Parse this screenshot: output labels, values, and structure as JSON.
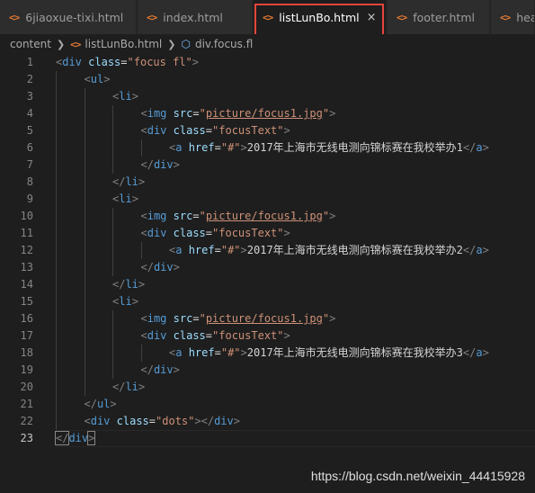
{
  "tabs": [
    {
      "label": "6jiaoxue-tixi.html",
      "icon": "html-icon",
      "active": false
    },
    {
      "label": "index.html",
      "icon": "html-icon",
      "active": false
    },
    {
      "label": "listLunBo.html",
      "icon": "html-icon",
      "active": true,
      "close": "×"
    },
    {
      "label": "footer.html",
      "icon": "html-icon",
      "active": false
    },
    {
      "label": "hea",
      "icon": "html-icon",
      "active": false
    }
  ],
  "icon_glyph": "<>",
  "breadcrumb": {
    "folder": "content",
    "file": "listLunBo.html",
    "symbol": "div.focus.fl"
  },
  "colors": {
    "tag": "#569cd6",
    "attr": "#9cdcfe",
    "string": "#ce9178",
    "punct": "#808080",
    "html_icon": "#e37933",
    "highlight_box": "#e8453c"
  },
  "code_lines": [
    {
      "n": "1",
      "indent": 0,
      "tokens": [
        [
          "p",
          "<"
        ],
        [
          "t",
          "div"
        ],
        [
          "x",
          " "
        ],
        [
          "a",
          "class"
        ],
        [
          "x",
          "="
        ],
        [
          "s",
          "\"focus fl\""
        ],
        [
          "p",
          ">"
        ]
      ]
    },
    {
      "n": "2",
      "indent": 1,
      "tokens": [
        [
          "p",
          "<"
        ],
        [
          "t",
          "ul"
        ],
        [
          "p",
          ">"
        ]
      ]
    },
    {
      "n": "3",
      "indent": 2,
      "tokens": [
        [
          "p",
          "<"
        ],
        [
          "t",
          "li"
        ],
        [
          "p",
          ">"
        ]
      ]
    },
    {
      "n": "4",
      "indent": 3,
      "tokens": [
        [
          "p",
          "<"
        ],
        [
          "t",
          "img"
        ],
        [
          "x",
          " "
        ],
        [
          "a",
          "src"
        ],
        [
          "x",
          "="
        ],
        [
          "s",
          "\""
        ],
        [
          "su",
          "picture/focus1.jpg"
        ],
        [
          "s",
          "\""
        ],
        [
          "p",
          ">"
        ]
      ]
    },
    {
      "n": "5",
      "indent": 3,
      "tokens": [
        [
          "p",
          "<"
        ],
        [
          "t",
          "div"
        ],
        [
          "x",
          " "
        ],
        [
          "a",
          "class"
        ],
        [
          "x",
          "="
        ],
        [
          "s",
          "\"focusText\""
        ],
        [
          "p",
          ">"
        ]
      ]
    },
    {
      "n": "6",
      "indent": 4,
      "tokens": [
        [
          "p",
          "<"
        ],
        [
          "t",
          "a"
        ],
        [
          "x",
          " "
        ],
        [
          "a",
          "href"
        ],
        [
          "x",
          "="
        ],
        [
          "s",
          "\"#\""
        ],
        [
          "p",
          ">"
        ],
        [
          "x",
          "2017年上海市无线电测向锦标赛在我校举办1"
        ],
        [
          "p",
          "</"
        ],
        [
          "t",
          "a"
        ],
        [
          "p",
          ">"
        ]
      ]
    },
    {
      "n": "7",
      "indent": 3,
      "tokens": [
        [
          "p",
          "</"
        ],
        [
          "t",
          "div"
        ],
        [
          "p",
          ">"
        ]
      ]
    },
    {
      "n": "8",
      "indent": 2,
      "tokens": [
        [
          "p",
          "</"
        ],
        [
          "t",
          "li"
        ],
        [
          "p",
          ">"
        ]
      ]
    },
    {
      "n": "9",
      "indent": 2,
      "tokens": [
        [
          "p",
          "<"
        ],
        [
          "t",
          "li"
        ],
        [
          "p",
          ">"
        ]
      ]
    },
    {
      "n": "10",
      "indent": 3,
      "tokens": [
        [
          "p",
          "<"
        ],
        [
          "t",
          "img"
        ],
        [
          "x",
          " "
        ],
        [
          "a",
          "src"
        ],
        [
          "x",
          "="
        ],
        [
          "s",
          "\""
        ],
        [
          "su",
          "picture/focus1.jpg"
        ],
        [
          "s",
          "\""
        ],
        [
          "p",
          ">"
        ]
      ]
    },
    {
      "n": "11",
      "indent": 3,
      "tokens": [
        [
          "p",
          "<"
        ],
        [
          "t",
          "div"
        ],
        [
          "x",
          " "
        ],
        [
          "a",
          "class"
        ],
        [
          "x",
          "="
        ],
        [
          "s",
          "\"focusText\""
        ],
        [
          "p",
          ">"
        ]
      ]
    },
    {
      "n": "12",
      "indent": 4,
      "tokens": [
        [
          "p",
          "<"
        ],
        [
          "t",
          "a"
        ],
        [
          "x",
          " "
        ],
        [
          "a",
          "href"
        ],
        [
          "x",
          "="
        ],
        [
          "s",
          "\"#\""
        ],
        [
          "p",
          ">"
        ],
        [
          "x",
          "2017年上海市无线电测向锦标赛在我校举办2"
        ],
        [
          "p",
          "</"
        ],
        [
          "t",
          "a"
        ],
        [
          "p",
          ">"
        ]
      ]
    },
    {
      "n": "13",
      "indent": 3,
      "tokens": [
        [
          "p",
          "</"
        ],
        [
          "t",
          "div"
        ],
        [
          "p",
          ">"
        ]
      ]
    },
    {
      "n": "14",
      "indent": 2,
      "tokens": [
        [
          "p",
          "</"
        ],
        [
          "t",
          "li"
        ],
        [
          "p",
          ">"
        ]
      ]
    },
    {
      "n": "15",
      "indent": 2,
      "tokens": [
        [
          "p",
          "<"
        ],
        [
          "t",
          "li"
        ],
        [
          "p",
          ">"
        ]
      ]
    },
    {
      "n": "16",
      "indent": 3,
      "tokens": [
        [
          "p",
          "<"
        ],
        [
          "t",
          "img"
        ],
        [
          "x",
          " "
        ],
        [
          "a",
          "src"
        ],
        [
          "x",
          "="
        ],
        [
          "s",
          "\""
        ],
        [
          "su",
          "picture/focus1.jpg"
        ],
        [
          "s",
          "\""
        ],
        [
          "p",
          ">"
        ]
      ]
    },
    {
      "n": "17",
      "indent": 3,
      "tokens": [
        [
          "p",
          "<"
        ],
        [
          "t",
          "div"
        ],
        [
          "x",
          " "
        ],
        [
          "a",
          "class"
        ],
        [
          "x",
          "="
        ],
        [
          "s",
          "\"focusText\""
        ],
        [
          "p",
          ">"
        ]
      ]
    },
    {
      "n": "18",
      "indent": 4,
      "tokens": [
        [
          "p",
          "<"
        ],
        [
          "t",
          "a"
        ],
        [
          "x",
          " "
        ],
        [
          "a",
          "href"
        ],
        [
          "x",
          "="
        ],
        [
          "s",
          "\"#\""
        ],
        [
          "p",
          ">"
        ],
        [
          "x",
          "2017年上海市无线电测向锦标赛在我校举办3"
        ],
        [
          "p",
          "</"
        ],
        [
          "t",
          "a"
        ],
        [
          "p",
          ">"
        ]
      ]
    },
    {
      "n": "19",
      "indent": 3,
      "tokens": [
        [
          "p",
          "</"
        ],
        [
          "t",
          "div"
        ],
        [
          "p",
          ">"
        ]
      ]
    },
    {
      "n": "20",
      "indent": 2,
      "tokens": [
        [
          "p",
          "</"
        ],
        [
          "t",
          "li"
        ],
        [
          "p",
          ">"
        ]
      ]
    },
    {
      "n": "21",
      "indent": 1,
      "tokens": [
        [
          "p",
          "</"
        ],
        [
          "t",
          "ul"
        ],
        [
          "p",
          ">"
        ]
      ]
    },
    {
      "n": "22",
      "indent": 1,
      "tokens": [
        [
          "p",
          "<"
        ],
        [
          "t",
          "div"
        ],
        [
          "x",
          " "
        ],
        [
          "a",
          "class"
        ],
        [
          "x",
          "="
        ],
        [
          "s",
          "\"dots\""
        ],
        [
          "p",
          ">"
        ],
        [
          "p",
          "</"
        ],
        [
          "t",
          "div"
        ],
        [
          "p",
          ">"
        ]
      ]
    },
    {
      "n": "23",
      "indent": 0,
      "tokens": [
        [
          "ph",
          "</"
        ],
        [
          "t",
          "div"
        ],
        [
          "ph",
          ">"
        ]
      ]
    }
  ],
  "current_line": "23",
  "watermark": "https://blog.csdn.net/weixin_44415928"
}
